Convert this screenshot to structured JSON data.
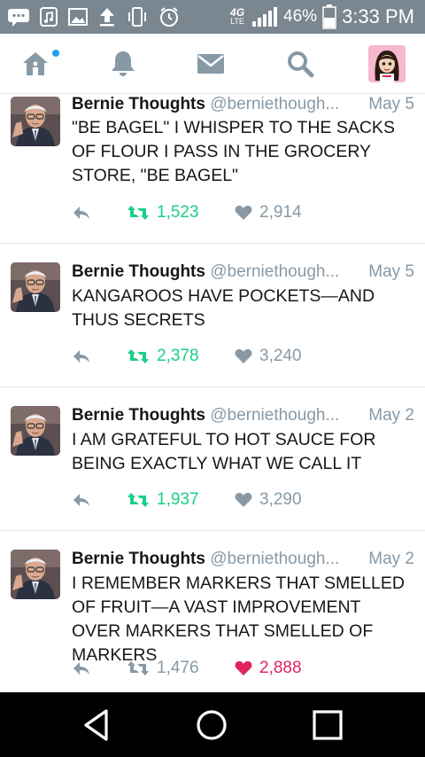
{
  "status_bar": {
    "battery": "46%",
    "time": "3:33 PM",
    "network": "4G",
    "network_sub": "LTE"
  },
  "tweets": [
    {
      "name": "Bernie Thoughts",
      "handle": "@berniethough...",
      "date": "May 5",
      "text": "\"BE BAGEL\" I WHISPER TO THE SACKS OF FLOUR I PASS IN THE GROCERY STORE, \"BE BAGEL\"",
      "retweets": "1,523",
      "likes": "2,914"
    },
    {
      "name": "Bernie Thoughts",
      "handle": "@berniethough...",
      "date": "May 5",
      "text": "KANGAROOS HAVE POCKETS—AND THUS SECRETS",
      "retweets": "2,378",
      "likes": "3,240"
    },
    {
      "name": "Bernie Thoughts",
      "handle": "@berniethough...",
      "date": "May 2",
      "text": "I AM GRATEFUL TO HOT SAUCE FOR BEING EXACTLY WHAT WE CALL IT",
      "retweets": "1,937",
      "likes": "3,290"
    },
    {
      "name": "Bernie Thoughts",
      "handle": "@berniethough...",
      "date": "May 2",
      "text": "I REMEMBER MARKERS THAT SMELLED OF FRUIT—A VAST IMPROVEMENT OVER MARKERS THAT SMELLED OF MARKERS",
      "retweets": "1,476",
      "likes": "2,888"
    }
  ]
}
